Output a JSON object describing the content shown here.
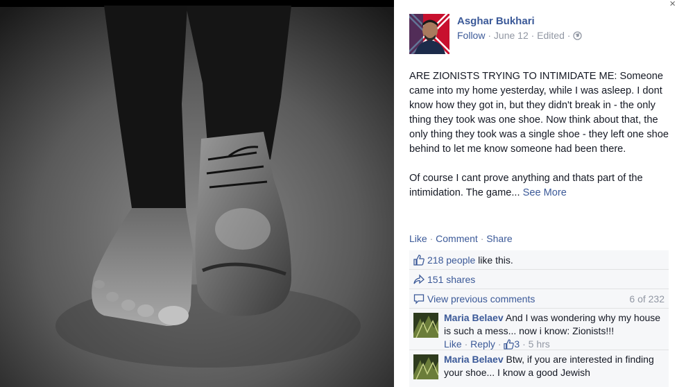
{
  "post": {
    "author": "Asghar Bukhari",
    "follow": "Follow",
    "date": " · June 12 · Edited · ",
    "paragraph1": "ARE ZIONISTS TRYING TO INTIMIDATE ME: Someone came into my home yesterday, while I was asleep. I dont know how they got in, but they didn't break in - the only thing they took was one shoe. Now think about that, the only thing they took was a single shoe - they left one shoe behind to let me know someone had been there.",
    "paragraph2": "Of course I cant prove anything and thats part of the intimidation. The game... ",
    "see_more": "See More",
    "close_glyph": "×"
  },
  "actions": {
    "like": "Like",
    "comment": "Comment",
    "share": "Share",
    "sep": " · "
  },
  "ufi": {
    "likes_link": "218 people",
    "likes_suffix": " like this.",
    "shares": "151 shares",
    "view_previous": "View previous comments",
    "comment_count": "6 of 232"
  },
  "comments": [
    {
      "name": "Maria Belaev",
      "text": " And I was wondering why my house is such a mess... now i know: Zionists!!!",
      "like": "Like",
      "reply": "Reply",
      "likes": "3",
      "time": "5 hrs"
    },
    {
      "name": "Maria Belaev",
      "text": " Btw, if you are interested in finding your shoe... I know a good Jewish"
    }
  ],
  "icons": {
    "like": "thumbs-up-icon",
    "share": "share-arrow-icon",
    "comment": "speech-bubble-icon",
    "globe": "globe-icon",
    "close": "close-icon"
  },
  "colors": {
    "link": "#3b5998",
    "muted": "#9197a3",
    "ufi_bg": "#f6f7f9"
  }
}
